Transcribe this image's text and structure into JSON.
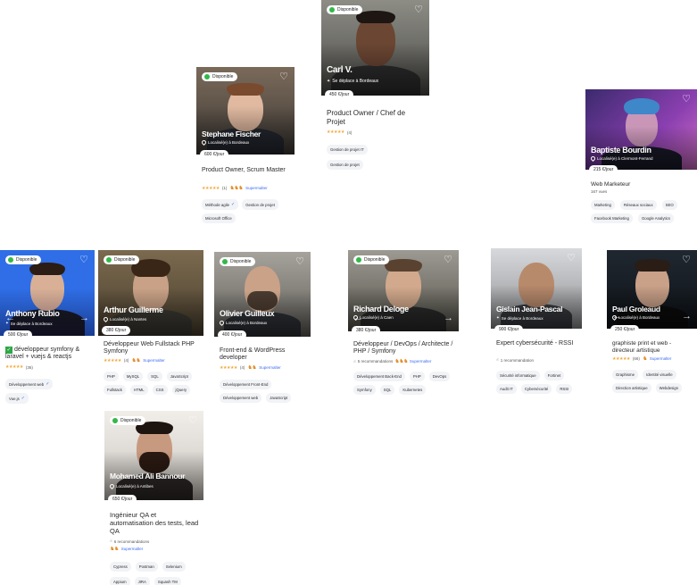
{
  "badge_label": "Disponible",
  "supermalter_label": "Supermalter",
  "cards": {
    "stephane": {
      "name": "Stephane Fischer",
      "location": "Localisé(e) à Bordeaux",
      "price": "600 €/jour",
      "title": "Product Owner, Scrum Master",
      "rating_count": "(1)",
      "tags": [
        "Méthode agile",
        "Gestion de projet",
        "Microsoft Office"
      ]
    },
    "carl": {
      "name": "Carl V.",
      "location": "Se déplace à Bordeaux",
      "price": "450 €/jour",
      "title": "Product Owner / Chef de Projet",
      "rating_count": "(4)",
      "tags": [
        "Gestion de projet IT",
        "Gestion de projet"
      ]
    },
    "baptiste": {
      "name": "Baptiste Bourdin",
      "location": "Localisé(e) à Clermont-Ferrand",
      "price": "215 €/jour",
      "title": "Web Marketeur",
      "views": "167 vues",
      "tags": [
        "Marketing",
        "Réseaux sociaux",
        "SEO",
        "Facebook Marketing",
        "Google Analytics"
      ]
    },
    "anthony": {
      "name": "Anthony Rubio",
      "location": "Se déplace à Bordeaux",
      "price": "500 €/jour",
      "title": "développeur symfony & laravel + vuejs & reactjs",
      "rating_count": "(36)",
      "tags": [
        "Développement web",
        "Vue.js"
      ]
    },
    "arthur": {
      "name": "Arthur Guillerme",
      "location": "Localisé(e) à Nantes",
      "price": "380 €/jour",
      "title": "Développeur Web Fullstack PHP Symfony",
      "rating_count": "(4)",
      "tags": [
        "PHP",
        "MySQL",
        "SQL",
        "JavaScript",
        "Fullstack",
        "HTML",
        "CSS",
        "jQuery"
      ]
    },
    "olivier": {
      "name": "Olivier Guilleux",
      "location": "Localisé(e) à Bordeaux",
      "price": "400 €/jour",
      "title": "Front-end & WordPress developer",
      "rating_count": "(4)",
      "tags": [
        "Développement Front-End",
        "Développement web",
        "JavaScript"
      ]
    },
    "richard": {
      "name": "Richard Deloge",
      "location": "Localisé(e) à Caen",
      "price": "380 €/jour",
      "title": "Développeur / DevOps / Architecte / PHP / Symfony",
      "recos": "5 recommandations",
      "tags": [
        "Développement Back-End",
        "PHP",
        "DevOps",
        "Symfony",
        "SQL",
        "Kubernetes"
      ]
    },
    "gislain": {
      "name": "Gislain Jean-Pascal",
      "location": "Se déplace à Bordeaux",
      "price": "900 €/jour",
      "title": "Expert cybersécurité - RSSI",
      "recos": "1 recommandation",
      "tags": [
        "Sécurité informatique",
        "Fortinet",
        "Audit IT",
        "Cybersécurité",
        "RSSI"
      ]
    },
    "paul": {
      "name": "Paul Groleaud",
      "location": "Localisé(e) à Bordeaux",
      "price": "250 €/jour",
      "title": "graphiste print et web - directeur artistique",
      "rating_count": "(66)",
      "tags": [
        "Graphisme",
        "Identité visuelle",
        "Direction artistique",
        "Webdesign"
      ]
    },
    "mohamed": {
      "name": "Mohamed Ali Bannour",
      "location": "Localisé(e) à Antibes",
      "price": "650 €/jour",
      "title": "Ingénieur QA et automatisation des tests, lead QA",
      "recos": "6 recommandations",
      "tags": [
        "Cypress",
        "Postman",
        "Selenium",
        "Appium",
        "JIRA",
        "Squash TM"
      ]
    }
  },
  "colors": {
    "available": "#33b84a",
    "supermalter": "#3b6cf2",
    "stars": "#f2a93b",
    "anthony_bg": "#2f6ee6",
    "baptiste_bg": "#7b3fa8"
  }
}
